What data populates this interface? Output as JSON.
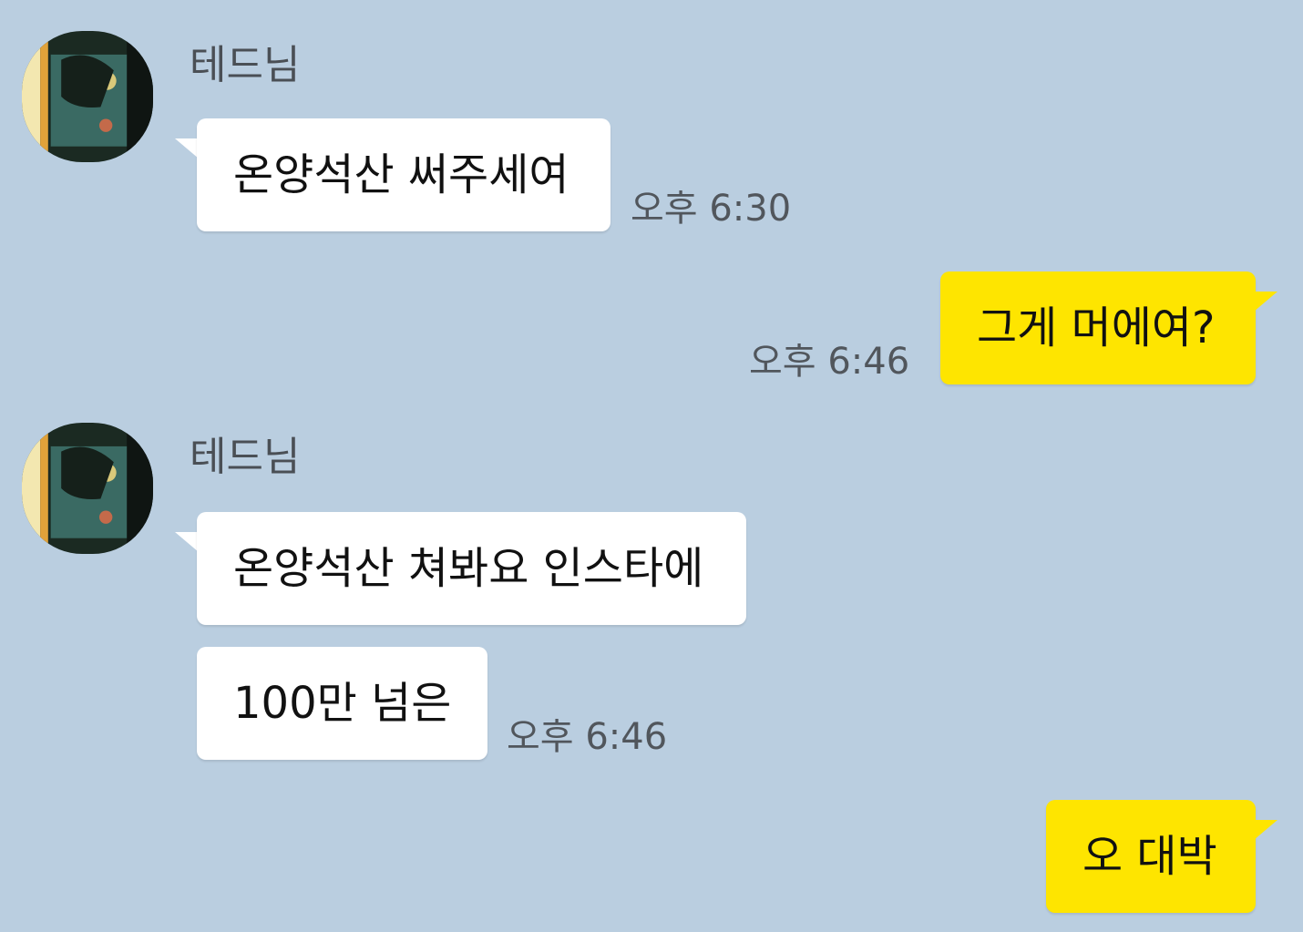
{
  "chat": {
    "background_color": "#BACEE0",
    "incoming_bubble_color": "#FFFFFF",
    "outgoing_bubble_color": "#FEE500",
    "groups": [
      {
        "sender": "테드님",
        "messages": [
          "온양석산 써주세여"
        ],
        "time": "오후 6:30"
      },
      {
        "messages": [
          "그게 머에여?"
        ],
        "time": "오후 6:46"
      },
      {
        "sender": "테드님",
        "messages": [
          "온양석산 쳐봐요 인스타에",
          "100만 넘은"
        ],
        "time": "오후 6:46"
      },
      {
        "messages": [
          "오 대박"
        ]
      }
    ]
  }
}
